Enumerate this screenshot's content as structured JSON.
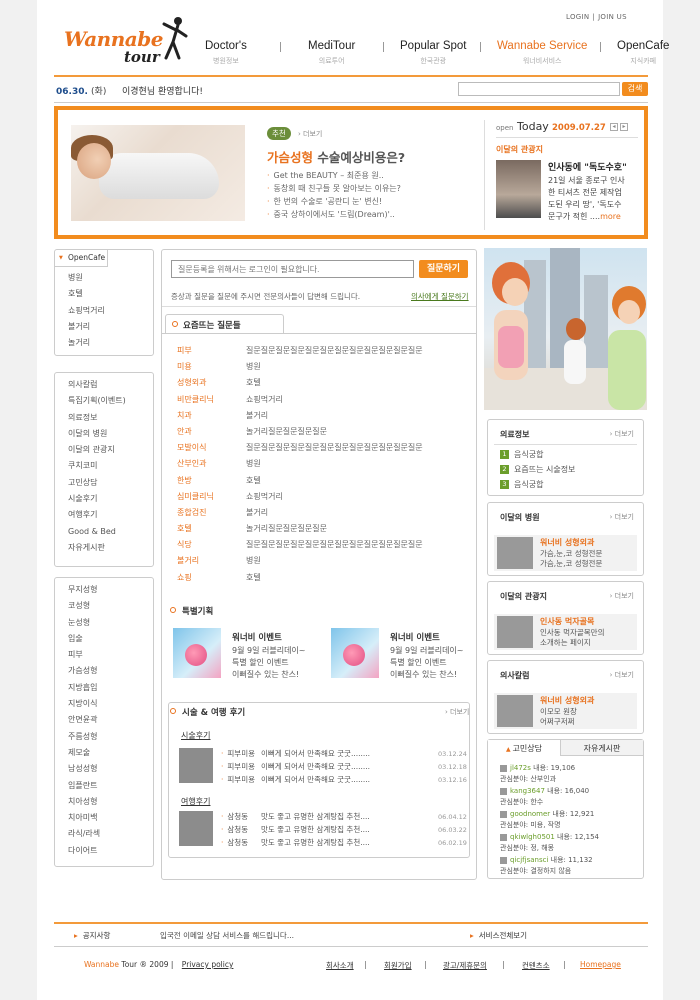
{
  "header": {
    "login": "LOGIN",
    "join": "JOIN US",
    "logo_main": "Wannabe",
    "logo_sub": "tour",
    "nav": [
      {
        "label": "Doctor's",
        "sub": "병원정보"
      },
      {
        "label": "MediTour",
        "sub": "의료투어"
      },
      {
        "label": "Popular Spot",
        "sub": "한국관광"
      },
      {
        "label": "Wannabe Service",
        "sub": "워너비서비스"
      },
      {
        "label": "OpenCafe",
        "sub": "지식카페"
      }
    ]
  },
  "bar": {
    "date": "06.30.",
    "day": "(화)",
    "welcome": "이경현님 환영합니다!",
    "search_btn": "검색"
  },
  "hero": {
    "tag": "추천",
    "more": "› 더보기",
    "title_em": "가슴성형",
    "title_rest": " 수술예상비용은?",
    "items": [
      "Get the BEAUTY – 최준용 원..",
      "동창회 때 친구들 못 알아보는 이유는?",
      "한 번의 수술로 '공란디 눈' 변신!",
      "중국 상하이에서도 '드림(Dream)'.."
    ],
    "open": "open",
    "today": "Today",
    "date": "2009.07.27",
    "sub": "이달의 관광지",
    "news_title": "인사동에 \"독도수호\"",
    "news_text_1": "21일 서울 종로구 인사",
    "news_text_2": "한 티셔츠 전문 제작업",
    "news_text_3": "도된 우리 땅', '독도수",
    "news_text_4": "문구가 적힌 ....",
    "news_more": "more"
  },
  "opencafe": {
    "tab": "OpenCafe",
    "items": [
      "병원",
      "호텔",
      "쇼핑먹거리",
      "볼거리",
      "놀거리"
    ]
  },
  "menu2": [
    "의사칼럼",
    "특집기획(이벤트)",
    "의료정보",
    "이달의 병원",
    "이달의 관광지",
    "쿠치코미",
    "고민상담",
    "시술후기",
    "여행후기",
    "Good & Bed",
    "자유게시판"
  ],
  "menu3": [
    "무지성형",
    "코성형",
    "눈성형",
    "입술",
    "피부",
    "가슴성형",
    "지방흡입",
    "지방이식",
    "안면윤곽",
    "주름성형",
    "제모술",
    "남성성형",
    "임플란트",
    "치아성형",
    "치아미백",
    "라식/라섹",
    "다이어트"
  ],
  "question": {
    "placeholder": "질문등록을 위해서는 로그인이 필요합니다.",
    "button": "질문하기",
    "text": "증상과 질문을 질문에 주시면 전문의사들이 답변해 드립니다.",
    "link": "의사에게 질문하기",
    "tab": "요즘뜨는 질문들",
    "rows": [
      {
        "c": "피부",
        "q": "질문질문질문질문질문질문질문질문질문질문질문질문"
      },
      {
        "c": "미용",
        "q": "병원"
      },
      {
        "c": "성형외과",
        "q": "호텔"
      },
      {
        "c": "비만클리닉",
        "q": "쇼핑먹거리"
      },
      {
        "c": "치과",
        "q": "볼거리"
      },
      {
        "c": "안과",
        "q": "놀거리질문질문질문질문"
      },
      {
        "c": "모발이식",
        "q": "질문질문질문질문질문질문질문질문질문질문질문질문"
      },
      {
        "c": "산부인과",
        "q": "병원"
      },
      {
        "c": "한방",
        "q": "호텔"
      },
      {
        "c": "심미클리닉",
        "q": "쇼핑먹거리"
      },
      {
        "c": "종합검진",
        "q": "볼거리"
      },
      {
        "c": "호텔",
        "q": "놀거리질문질문질문질문"
      },
      {
        "c": "식당",
        "q": "질문질문질문질문질문질문질문질문질문질문질문질문"
      },
      {
        "c": "볼거리",
        "q": "병원"
      },
      {
        "c": "쇼핑",
        "q": "호텔"
      }
    ]
  },
  "special": {
    "title": "특별기획",
    "events": [
      {
        "img": "Happy Baby Party",
        "t": "워너비 이벤트",
        "d1": "9월 9일 러블리데이~",
        "d2": "특별 할인 이벤트",
        "d3": "이뻐질수 있는 찬스!"
      },
      {
        "img": "Happy Baby Party",
        "t": "워너비 이벤트",
        "d1": "9월 9일 러블리데이~",
        "d2": "특별 할인 이벤트",
        "d3": "이뻐질수 있는 찬스!"
      }
    ]
  },
  "reviews": {
    "title": "시술 & 여행 후기",
    "more": "› 더보기",
    "sub1": "시술후기",
    "sub2": "여행후기",
    "list1": [
      {
        "cat": "피부미용",
        "t": "이뻐게 되어서 만족해요 굿굿........",
        "d": "03.12.24"
      },
      {
        "cat": "피부미용",
        "t": "이뻐게 되어서 만족해요 굿굿........",
        "d": "03.12.18"
      },
      {
        "cat": "피부미용",
        "t": "이뻐게 되어서 만족해요 굿굿........",
        "d": "03.12.16"
      }
    ],
    "list2": [
      {
        "cat": "삼청동",
        "t": "맛도 좋고 유명한 삼계탕집 추천....",
        "d": "06.04.12"
      },
      {
        "cat": "삼청동",
        "t": "맛도 좋고 유명한 삼계탕집 추천....",
        "d": "06.03.22"
      },
      {
        "cat": "삼청동",
        "t": "맛도 좋고 유명한 삼계탕집 추천....",
        "d": "06.02.19"
      }
    ]
  },
  "medinfo": {
    "title": "의료정보",
    "more": "› 더보기",
    "items": [
      "음식궁합",
      "요즘뜨는 시술정보",
      "음식궁합"
    ]
  },
  "hospital": {
    "title": "이달의 병원",
    "more": "› 더보기",
    "name": "워너비 성형외과",
    "d1": "가슴,눈,코 성형전문",
    "d2": "가슴,눈,코 성형전문"
  },
  "tour": {
    "title": "이달의 관광지",
    "more": "› 더보기",
    "name": "인사동 먹자골목",
    "d1": "인사동 먹자골목만의",
    "d2": "소개하는 페이지"
  },
  "column": {
    "title": "의사칼럼",
    "more": "› 더보기",
    "name": "워너비 성형외과",
    "d1": "이모모 원장",
    "d2": "어쩌구저쩌"
  },
  "consult": {
    "tab1": "고민상담",
    "tab2": "자유게시판",
    "rows": [
      {
        "id": "jl472s",
        "n": "내용: 19,106",
        "f": "관심분야: 산부인과"
      },
      {
        "id": "kang3647",
        "n": "내용: 16,040",
        "f": "관심분야: 한수"
      },
      {
        "id": "goodnomer",
        "n": "내용: 12,921",
        "f": "관심분야: 미용, 작명"
      },
      {
        "id": "qkiwlgh0501",
        "n": "내용: 12,154",
        "f": "관심분야: 정, 해몽"
      },
      {
        "id": "qicjfjsansci",
        "n": "내용: 11,132",
        "f": "관심분야: 결정하지 않음"
      }
    ]
  },
  "footer": {
    "notice": "공지사항",
    "msg": "입국전 이메일 상담 서비스를 해드립니다...",
    "all": "서비스전체보기",
    "brand": "Wannabe",
    "copy": "Tour ® 2009",
    "privacy": "Privacy policy",
    "links": [
      "회사소개",
      "회원가입",
      "광고/제휴문의",
      "컨텐츠소",
      "Homepage"
    ]
  }
}
